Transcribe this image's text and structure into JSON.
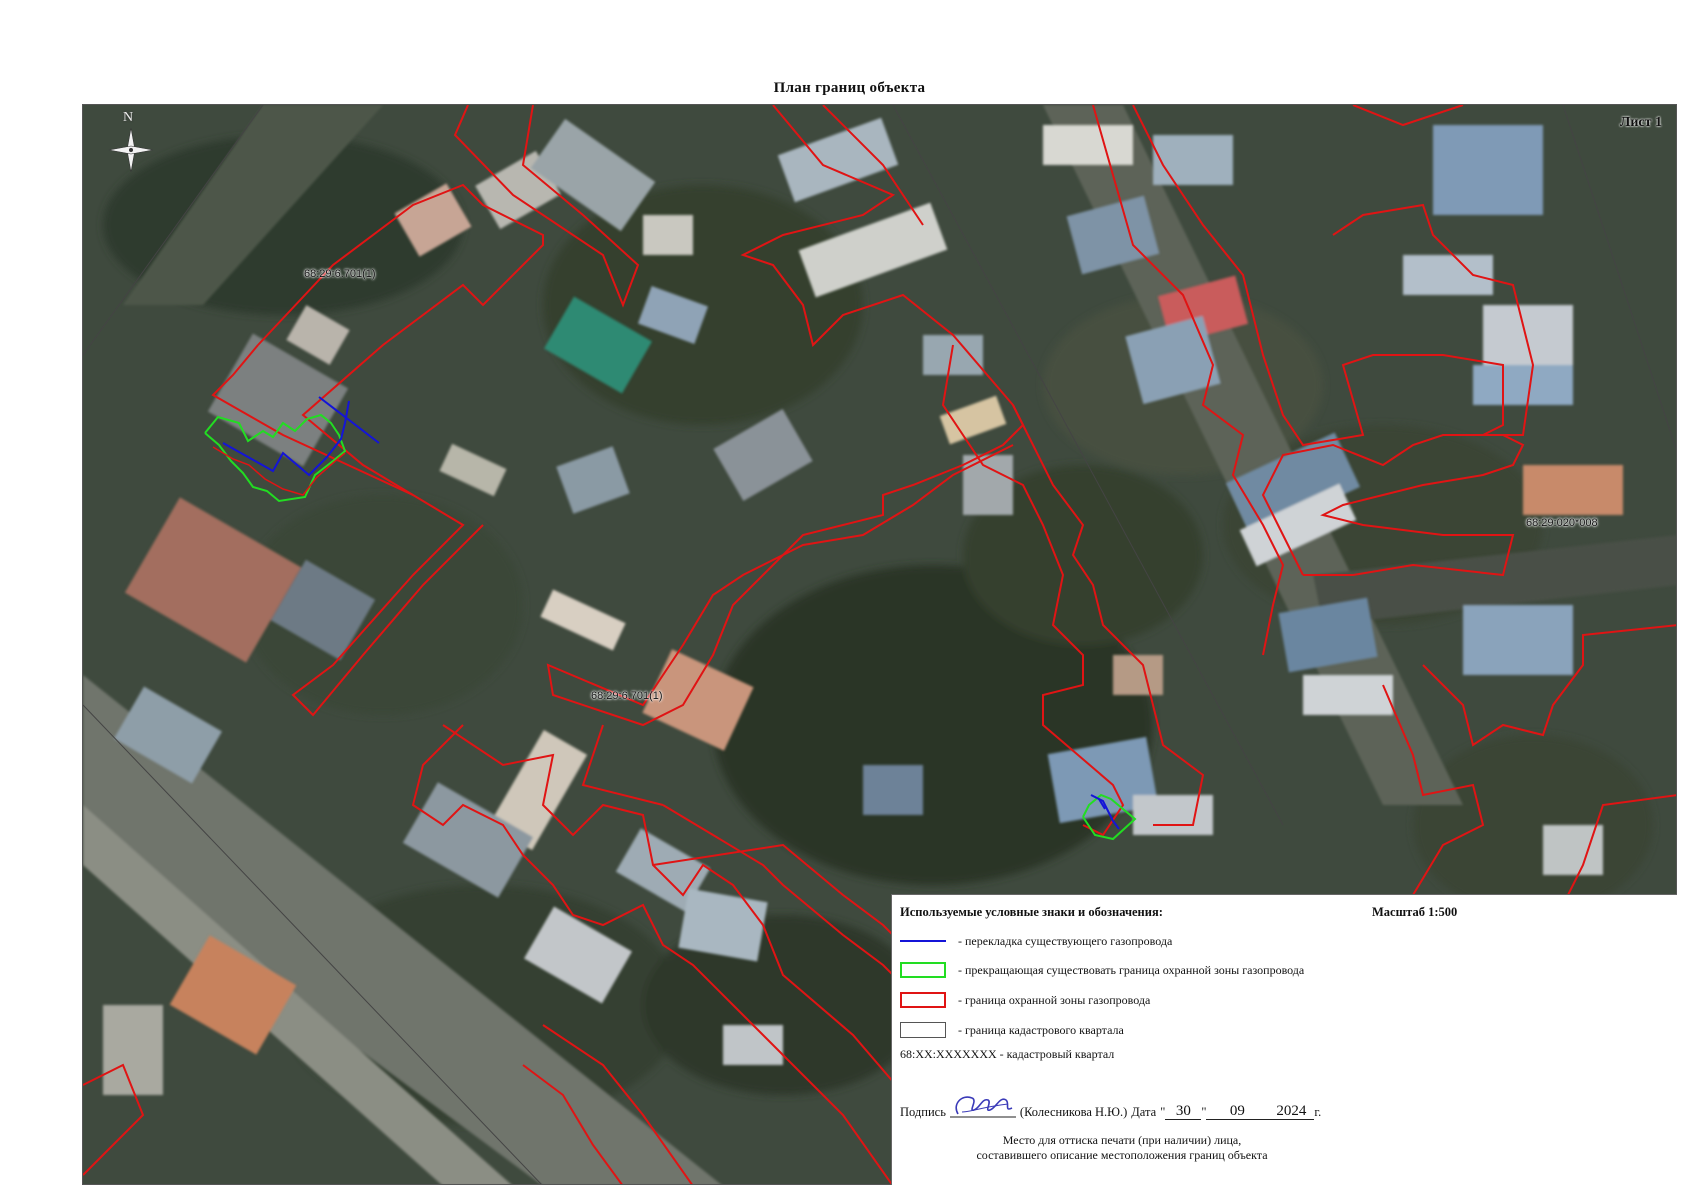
{
  "page": {
    "title": "План границ объекта",
    "sheet_label": "Лист 1"
  },
  "map": {
    "compass_letter": "N",
    "cadastral_labels": [
      {
        "id": "cad-label-1",
        "text": "68:29:6.701(1)"
      },
      {
        "id": "cad-label-2",
        "text": "68:29:6.701(1)"
      },
      {
        "id": "cad-label-3",
        "text": "68:29:020*008"
      }
    ],
    "colors": {
      "gas_pipeline": "#1414d8",
      "terminated_zone": "#22dd22",
      "protection_zone": "#e01414",
      "cadastral_boundary": "#444444"
    }
  },
  "legend": {
    "title": "Используемые условные знаки и обозначения:",
    "scale": "Масштаб 1:500",
    "items": [
      {
        "swatch": "blue-line",
        "label": "- перекладка существующего газопровода"
      },
      {
        "swatch": "green-box",
        "label": "- прекращающая существовать граница охранной зоны газопровода"
      },
      {
        "swatch": "red-box",
        "label": "- граница охранной зоны газопровода"
      },
      {
        "swatch": "gray-box",
        "label": "- граница кадастрового квартала"
      }
    ],
    "cadastral_legend": "68:XX:XXXXXXX - кадастровый квартал"
  },
  "signature": {
    "label": "Подпись",
    "name": "(Колесникова Н.Ю.)",
    "date_label": "Дата",
    "day": "30",
    "month": "09",
    "year": "2024",
    "year_suffix": "г.",
    "stamp_line1": "Место для оттиска печати (при наличии) лица,",
    "stamp_line2": "составившего описание местоположения границ объекта"
  }
}
